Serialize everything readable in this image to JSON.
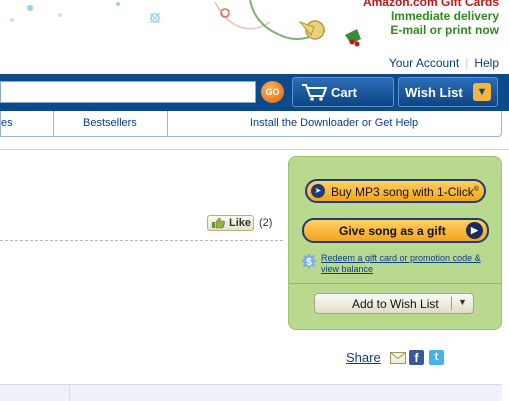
{
  "promo": {
    "line1": "Amazon.com Gift Cards",
    "line2": "Immediate delivery",
    "line3": "E-mail or print now"
  },
  "account_links": {
    "your_account": "Your Account",
    "help": "Help"
  },
  "nav": {
    "go_label": "GO",
    "cart_label": "Cart",
    "wish_list_label": "Wish List"
  },
  "subnav": {
    "items": [
      "es",
      "Bestsellers",
      "Install the Downloader or Get Help"
    ]
  },
  "like": {
    "label": "Like",
    "count": "(2)"
  },
  "buybox": {
    "buy_label": "Buy MP3 song with 1-Click",
    "buy_sup": "®",
    "gift_label": "Give song as a gift",
    "redeem_text": "Redeem a gift card or promotion code & view balance",
    "add_wish_label": "Add to Wish List"
  },
  "share": {
    "label": "Share"
  },
  "icons": {
    "cart": "cart-icon",
    "dropdown": "chevron-down-icon",
    "thumb": "thumbs-up-icon",
    "buy": "cursor-click-icon",
    "gift_arrow": "play-arrow-icon",
    "redeem": "dollar-badge-icon",
    "mail": "mail-icon",
    "facebook": "facebook-icon",
    "twitter": "twitter-icon"
  },
  "colors": {
    "nav_blue": "#0d4a8c",
    "button_orange": "#f3a51b",
    "buybox_green": "#b9d98e",
    "link_blue": "#0a3d8a",
    "promo_red": "#c01818",
    "promo_green": "#2f8b1e"
  }
}
